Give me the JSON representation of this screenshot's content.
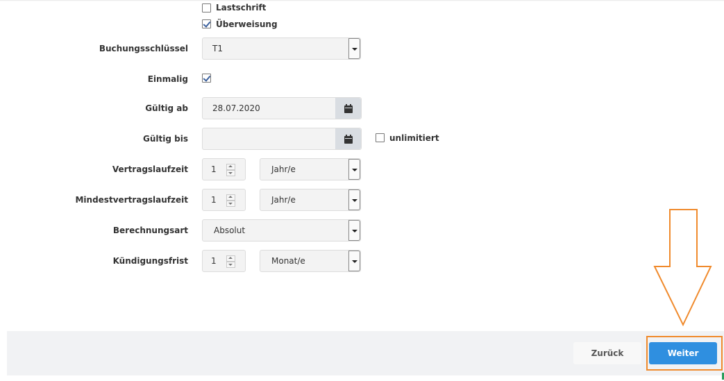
{
  "payment_methods": {
    "lastschrift": {
      "label": "Lastschrift",
      "checked": false
    },
    "ueberweisung": {
      "label": "Überweisung",
      "checked": true
    }
  },
  "form": {
    "buchungsschluessel": {
      "label": "Buchungsschlüssel",
      "value": "T1"
    },
    "einmalig": {
      "label": "Einmalig",
      "checked": true
    },
    "gueltig_ab": {
      "label": "Gültig ab",
      "value": "28.07.2020"
    },
    "gueltig_bis": {
      "label": "Gültig bis",
      "value": "",
      "unlimited_label": "unlimitiert",
      "unlimited_checked": false
    },
    "vertragslaufzeit": {
      "label": "Vertragslaufzeit",
      "value": "1",
      "unit": "Jahr/e"
    },
    "mindestvertragslaufzeit": {
      "label": "Mindestvertragslaufzeit",
      "value": "1",
      "unit": "Jahr/e"
    },
    "berechnungsart": {
      "label": "Berechnungsart",
      "value": "Absolut"
    },
    "kuendigungsfrist": {
      "label": "Kündigungsfrist",
      "value": "1",
      "unit": "Monat/e"
    }
  },
  "footer": {
    "back_label": "Zurück",
    "next_label": "Weiter"
  },
  "icons": {
    "calendar": "calendar-icon",
    "annotation": "down-arrow-annotation"
  },
  "colors": {
    "primary": "#2f8fe0",
    "annotation": "#f08a2c",
    "footer_bg": "#f1f2f4"
  }
}
